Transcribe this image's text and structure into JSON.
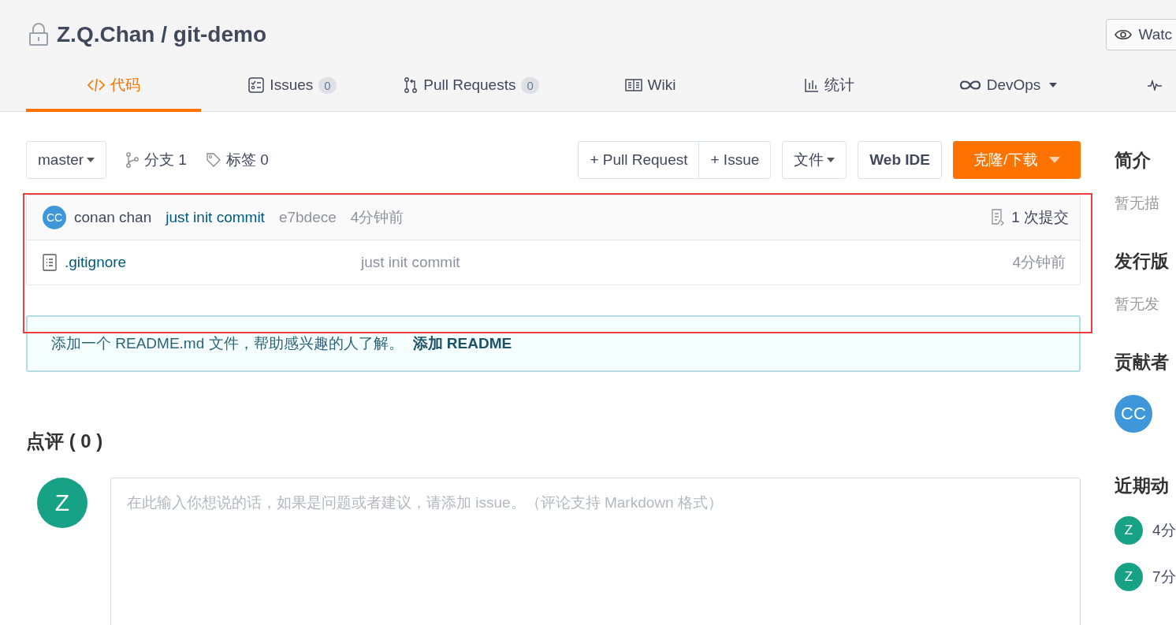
{
  "repo": {
    "owner": "Z.Q.Chan",
    "separator": "/",
    "name": "git-demo",
    "private": true
  },
  "watch_button": {
    "label": "Watc"
  },
  "tabs": [
    {
      "label": "代码",
      "selected": true
    },
    {
      "label": "Issues",
      "count": "0",
      "selected": false
    },
    {
      "label": "Pull Requests",
      "count": "0",
      "selected": false
    },
    {
      "label": "Wiki",
      "selected": false
    },
    {
      "label": "统计",
      "selected": false
    },
    {
      "label": "DevOps",
      "dropdown": true,
      "selected": false
    },
    {
      "selected": false
    }
  ],
  "toolbar": {
    "branch": "master",
    "branches": "分支 1",
    "tags": "标签 0",
    "pr_button": "+ Pull Request",
    "issue_button": "+ Issue",
    "file_button": "文件",
    "webide_button": "Web IDE",
    "clone_button": "克隆/下载"
  },
  "last_commit": {
    "avatar": "CC",
    "author": "conan chan",
    "message": "just init commit",
    "hash": "e7bdece",
    "time": "4分钟前",
    "commits": "1 次提交"
  },
  "files": [
    {
      "name": ".gitignore",
      "message": "just init commit",
      "time": "4分钟前"
    }
  ],
  "readme_notice": {
    "text": "添加一个 README.md 文件，帮助感兴趣的人了解。",
    "link": "添加 README"
  },
  "highlight": {
    "shown": true
  },
  "comments": {
    "title": "点评 ( 0 )",
    "avatar": "Z",
    "placeholder": "在此输入你想说的话，如果是问题或者建议，请添加 issue。（评论支持 Markdown 格式）"
  },
  "sidebar": {
    "intro_title": "简介",
    "intro_text": "暂无描",
    "release_title": "发行版",
    "release_text": "暂无发",
    "contributors_title": "贡献者",
    "contributors": [
      {
        "initials": "CC",
        "color": "#3d97d8"
      }
    ],
    "activity_title": "近期动",
    "activity": [
      {
        "initials": "Z",
        "time": "4分"
      },
      {
        "initials": "Z",
        "time": "7分"
      }
    ]
  }
}
